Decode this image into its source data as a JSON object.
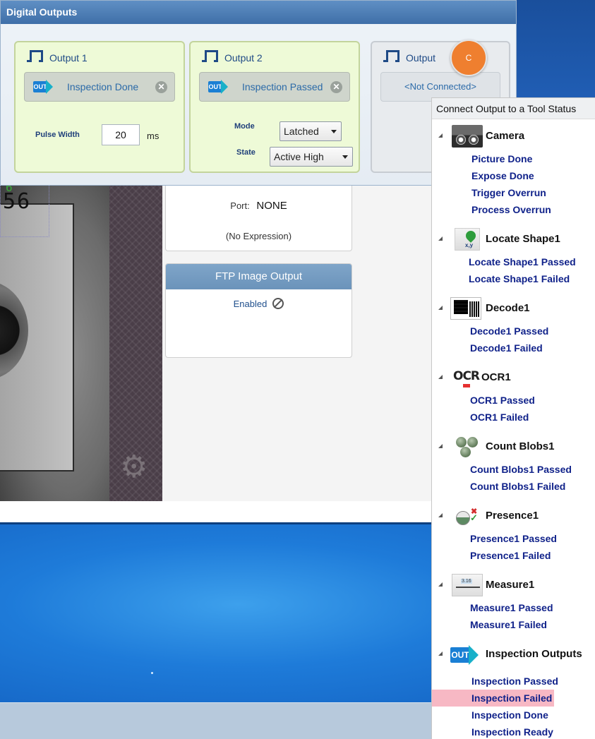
{
  "dialog": {
    "title": "Digital Outputs",
    "outputs": [
      {
        "name": "Output 1",
        "source": "Inspection Done",
        "pulse_width_label": "Pulse Width",
        "pulse_width_value": "20",
        "pulse_width_unit": "ms"
      },
      {
        "name": "Output 2",
        "source": "Inspection Passed",
        "mode_label": "Mode",
        "mode_value": "Latched",
        "state_label": "State",
        "state_value": "Active High"
      },
      {
        "name": "Output",
        "source": "<Not Connected>"
      }
    ],
    "marker_label": "C",
    "badge_text": "OUT"
  },
  "port_panel": {
    "port_label": "Port:",
    "port_value": "NONE",
    "expression": "(No Expression)"
  },
  "ftp_panel": {
    "title": "FTP Image Output",
    "enabled_label": "Enabled"
  },
  "camera_view": {
    "digits": "56",
    "overlay_digit": "6"
  },
  "popup": {
    "header": "Connect Output to a Tool Status",
    "groups": [
      {
        "name": "Camera",
        "icon": "camera-icon",
        "items": [
          "Picture Done",
          "Expose Done",
          "Trigger Overrun",
          "Process Overrun"
        ]
      },
      {
        "name": "Locate Shape1",
        "icon": "locate-shape-icon",
        "items": [
          "Locate Shape1 Passed",
          "Locate Shape1 Failed"
        ]
      },
      {
        "name": "Decode1",
        "icon": "decode-icon",
        "items": [
          "Decode1 Passed",
          "Decode1 Failed"
        ]
      },
      {
        "name": "OCR1",
        "icon": "ocr-icon",
        "icon_text": "OCR",
        "items": [
          "OCR1 Passed",
          "OCR1 Failed"
        ]
      },
      {
        "name": "Count Blobs1",
        "icon": "count-blobs-icon",
        "items": [
          "Count Blobs1 Passed",
          "Count Blobs1 Failed"
        ]
      },
      {
        "name": "Presence1",
        "icon": "presence-icon",
        "items": [
          "Presence1 Passed",
          "Presence1 Failed"
        ]
      },
      {
        "name": "Measure1",
        "icon": "measure-icon",
        "items": [
          "Measure1 Passed",
          "Measure1 Failed"
        ]
      },
      {
        "name": "Inspection Outputs",
        "icon": "inspection-outputs-icon",
        "icon_text": "OUT",
        "items": [
          "Inspection Passed",
          "Inspection Failed",
          "Inspection Done",
          "Inspection Ready"
        ],
        "selected_item": "Inspection Failed"
      }
    ]
  },
  "colors": {
    "title_bar": "#4a7bb4",
    "connected_card": "#eefad7",
    "link_text": "#10228a",
    "selected_highlight": "#f7b8c4",
    "marker": "#ef7f2f"
  }
}
